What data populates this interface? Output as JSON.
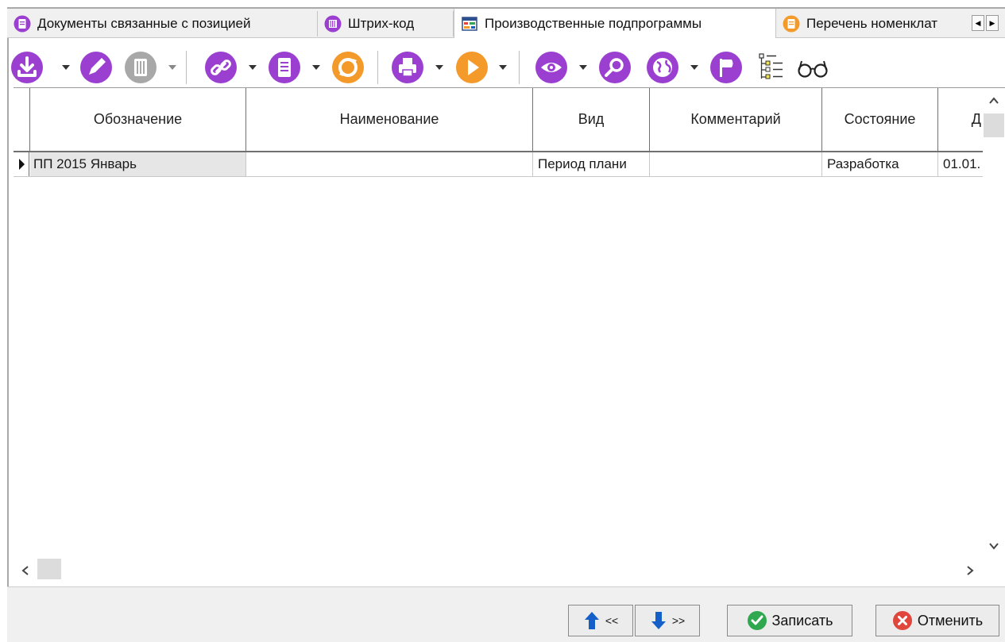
{
  "tabs": [
    {
      "label": "Документы связанные с позицией",
      "icon": "document-link-icon"
    },
    {
      "label": "Штрих-код",
      "icon": "barcode-icon"
    },
    {
      "label": "Производственные подпрограммы",
      "icon": "production-table-icon"
    },
    {
      "label": "Перечень номенклат",
      "icon": "nomenclature-list-icon"
    }
  ],
  "toolbar": {
    "icons": [
      "import-icon",
      "edit-icon",
      "delete-icon",
      "link-icon",
      "document-icon",
      "refresh-icon",
      "print-icon",
      "play-icon",
      "view-icon",
      "search-icon",
      "globe-icon",
      "flag-icon",
      "tree-icon",
      "glasses-icon"
    ]
  },
  "grid": {
    "columns": [
      "Обозначение",
      "Наименование",
      "Вид",
      "Комментарий",
      "Состояние",
      "Д"
    ],
    "rows": [
      {
        "designation": "ПП 2015 Январь",
        "name": "",
        "kind": "Период плани",
        "comment": "",
        "state": "Разработка",
        "date": "01.01."
      }
    ]
  },
  "footer": {
    "prev_label": "<<",
    "next_label": ">>",
    "save_label": "Записать",
    "cancel_label": "Отменить"
  },
  "colors": {
    "accent": "#9b3fd1",
    "orange": "#f39a2b",
    "green": "#2fa84f",
    "red": "#e0463b",
    "blue": "#1560c8"
  }
}
